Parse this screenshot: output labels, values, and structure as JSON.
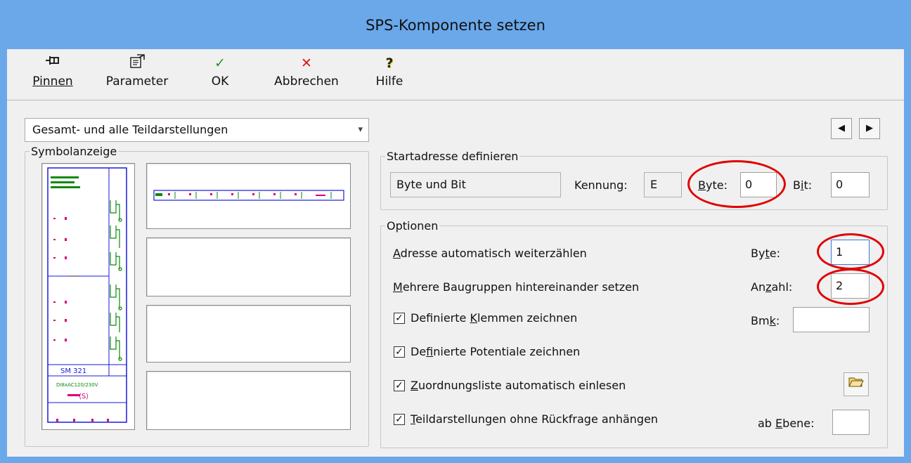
{
  "window": {
    "title": "SPS-Komponente setzen"
  },
  "toolbar": {
    "pin": {
      "icon": "pin-icon",
      "label": "Pinnen"
    },
    "params": {
      "icon": "properties-icon",
      "label": "Parameter"
    },
    "ok": {
      "icon": "checkmark-icon",
      "label": "OK"
    },
    "cancel": {
      "icon": "cross-icon",
      "label": "Abbrechen"
    },
    "help": {
      "icon": "help-icon",
      "label": "Hilfe"
    }
  },
  "view_select": {
    "selected": "Gesamt- und alle Teildarstellungen"
  },
  "symbol_panel": {
    "legend": "Symbolanzeige",
    "module_label": "SM 321",
    "module_voltage": "DI8xAC120/230V"
  },
  "address": {
    "legend": "Startadresse definieren",
    "mode": "Byte und Bit",
    "kennung_label": "Kennung:",
    "kennung": "E",
    "byte_label": "Byte:",
    "byte": "0",
    "bit_label": "Bit:",
    "bit": "0"
  },
  "options": {
    "legend": "Optionen",
    "auto_count_label": "Adresse automatisch weiterzählen",
    "auto_count_byte_label": "Byte:",
    "auto_count_byte": "1",
    "multi_label": "Mehrere Baugruppen hintereinander setzen",
    "count_label": "Anzahl:",
    "count": "2",
    "terminals_label": "Definierte Klemmen zeichnen",
    "bmk_label": "Bmk:",
    "bmk": "",
    "potentials_label": "Definierte Potentiale zeichnen",
    "assign_label": "Zuordnungsliste automatisch einlesen",
    "partial_label": "Teildarstellungen ohne Rückfrage anhängen",
    "level_label": "ab Ebene:",
    "level": ""
  },
  "colors": {
    "titlebar": "#6aa8ea",
    "highlight": "#e00000",
    "schematic_green": "#0a8a0a",
    "schematic_blue": "#1a1adb",
    "schematic_pink": "#d4007a"
  }
}
